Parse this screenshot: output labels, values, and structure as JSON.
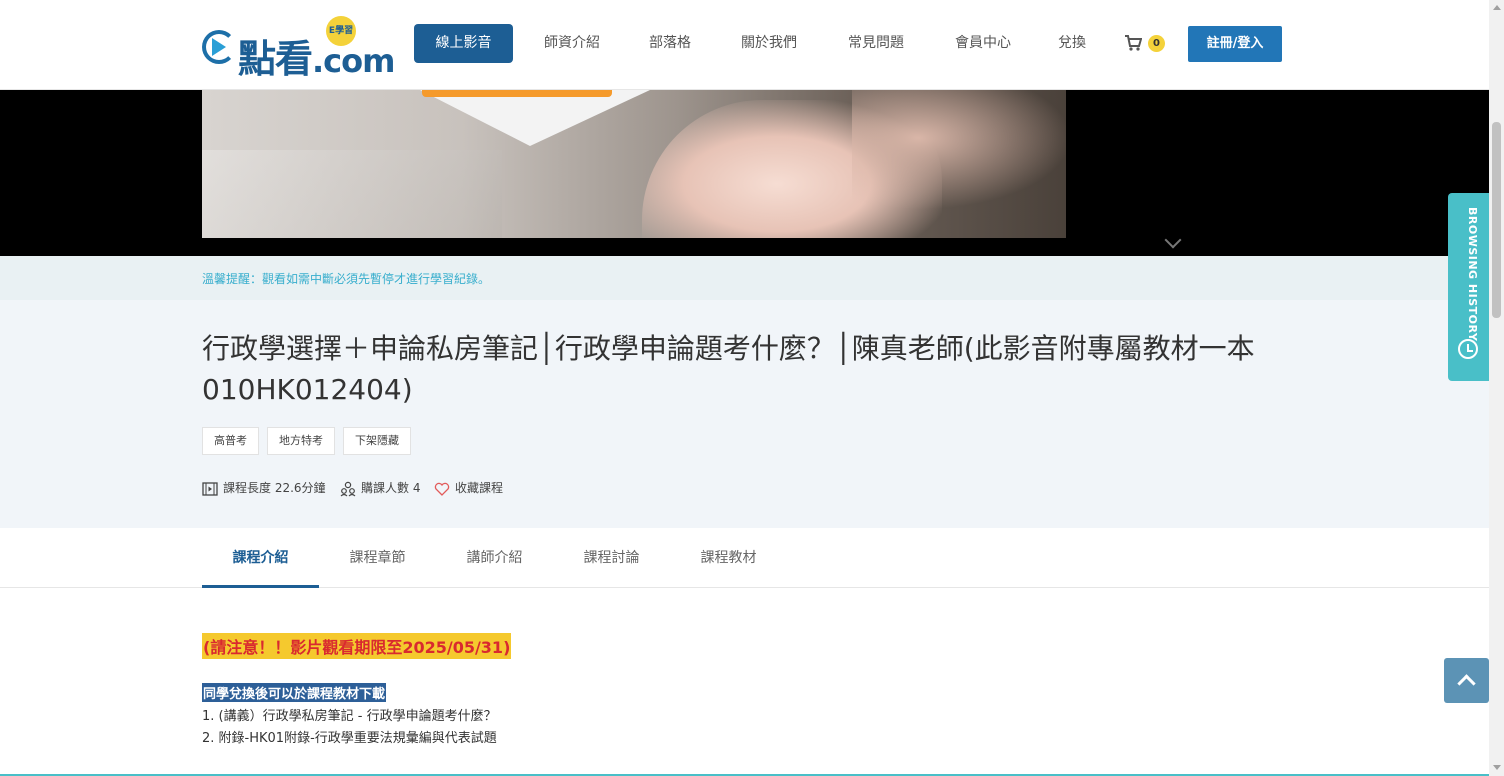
{
  "header": {
    "logo_main": "點看",
    "logo_suffix": ".com",
    "logo_badge": "E學習",
    "nav": [
      {
        "label": "線上影音",
        "active": true
      },
      {
        "label": "師資介紹",
        "active": false
      },
      {
        "label": "部落格",
        "active": false
      },
      {
        "label": "關於我們",
        "active": false
      },
      {
        "label": "常見問題",
        "active": false
      },
      {
        "label": "會員中心",
        "active": false
      },
      {
        "label": "兌換",
        "active": false
      }
    ],
    "cart_count": "0",
    "login_label": "註冊/登入"
  },
  "notice": "溫馨提醒：觀看如需中斷必須先暫停才進行學習紀錄。",
  "course": {
    "title": "行政學選擇＋申論私房筆記│行政學申論題考什麼？│陳真老師(此影音附專屬教材一本010HK012404)",
    "tags": [
      "高普考",
      "地方特考",
      "下架隱藏"
    ],
    "meta": {
      "length_label": "課程長度 22.6分鐘",
      "buyers_label": "購課人數 4",
      "favorite_label": "收藏課程"
    }
  },
  "tabs": [
    {
      "label": "課程介紹",
      "active": true
    },
    {
      "label": "課程章節",
      "active": false
    },
    {
      "label": "講師介紹",
      "active": false
    },
    {
      "label": "課程討論",
      "active": false
    },
    {
      "label": "課程教材",
      "active": false
    }
  ],
  "content": {
    "warning": "(請注意！！影片觀看期限至2025/05/31)",
    "highlight": "同學兌換後可以於課程教材下載",
    "items": [
      "1. (講義）行政學私房筆記 - 行政學申論題考什麼？",
      "2. 附錄-HK01附錄-行政學重要法規彙編與代表試題"
    ]
  },
  "side": {
    "history_label": "BROWSING HISTORY"
  },
  "colors": {
    "brand": "#1d5e94",
    "accent_teal": "#49bfc8",
    "warning_bg": "#f5c92e",
    "warning_text": "#d9292f"
  }
}
